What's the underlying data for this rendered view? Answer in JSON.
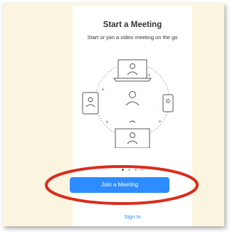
{
  "screen": {
    "title": "Start a Meeting",
    "subtitle": "Start or join a video meeting on the go"
  },
  "carousel": {
    "pages": 4,
    "active": 1
  },
  "actions": {
    "join_label": "Join a Meeting",
    "signin_label": "Sign In"
  },
  "colors": {
    "accent": "#2d8cff",
    "highlight": "#d92c1f",
    "background": "#fbf5df"
  }
}
